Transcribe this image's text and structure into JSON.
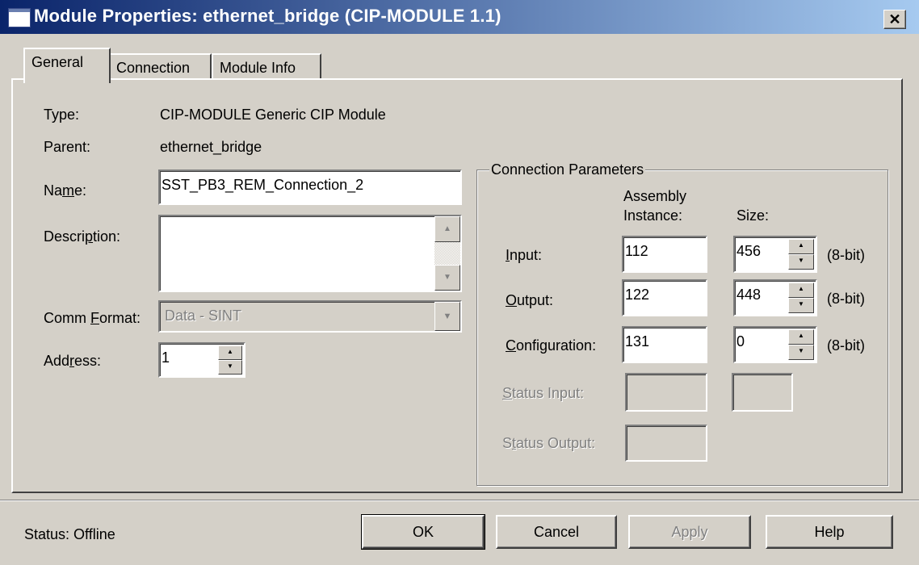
{
  "window": {
    "title": "Module Properties: ethernet_bridge (CIP-MODULE 1.1)",
    "close_glyph": "✕"
  },
  "tabs": [
    {
      "label": "General",
      "active": true
    },
    {
      "label": "Connection",
      "active": false
    },
    {
      "label": "Module Info",
      "active": false
    }
  ],
  "general": {
    "type_label": "Type:",
    "type_value": "CIP-MODULE Generic CIP Module",
    "parent_label": "Parent:",
    "parent_value": "ethernet_bridge",
    "name_label_pre": "Na",
    "name_label_ul": "m",
    "name_label_post": "e:",
    "name_value": "SST_PB3_REM_Connection_2",
    "description_label_pre": "Descri",
    "description_label_ul": "p",
    "description_label_post": "tion:",
    "description_value": "",
    "comm_format_label_pre": "Comm ",
    "comm_format_label_ul": "F",
    "comm_format_label_post": "ormat:",
    "comm_format_value": "Data - SINT",
    "address_label_pre": "Add",
    "address_label_ul": "r",
    "address_label_post": "ess:",
    "address_value": "1"
  },
  "connection_parameters": {
    "title": "Connection Parameters",
    "col_assembly_line1": "Assembly",
    "col_assembly_line2": "Instance:",
    "col_size": "Size:",
    "rows": [
      {
        "label_ul": "I",
        "label_rest": "nput:",
        "instance": "112",
        "size": "456",
        "unit": "(8-bit)"
      },
      {
        "label_ul": "O",
        "label_rest": "utput:",
        "instance": "122",
        "size": "448",
        "unit": "(8-bit)"
      },
      {
        "label_ul": "C",
        "label_rest": "onfiguration:",
        "instance": "131",
        "size": "0",
        "unit": "(8-bit)"
      }
    ],
    "status_input_label_ul": "S",
    "status_input_label_rest": "tatus Input:",
    "status_output_label_pre": "S",
    "status_output_label_ul": "t",
    "status_output_label_post": "atus Output:"
  },
  "footer": {
    "status_text": "Status:  Offline",
    "ok": "OK",
    "cancel": "Cancel",
    "apply": "Apply",
    "help": "Help"
  },
  "colors": {
    "titlebar_start": "#0a246a",
    "titlebar_end": "#a6caf0",
    "dialog_face": "#d4d0c8"
  }
}
